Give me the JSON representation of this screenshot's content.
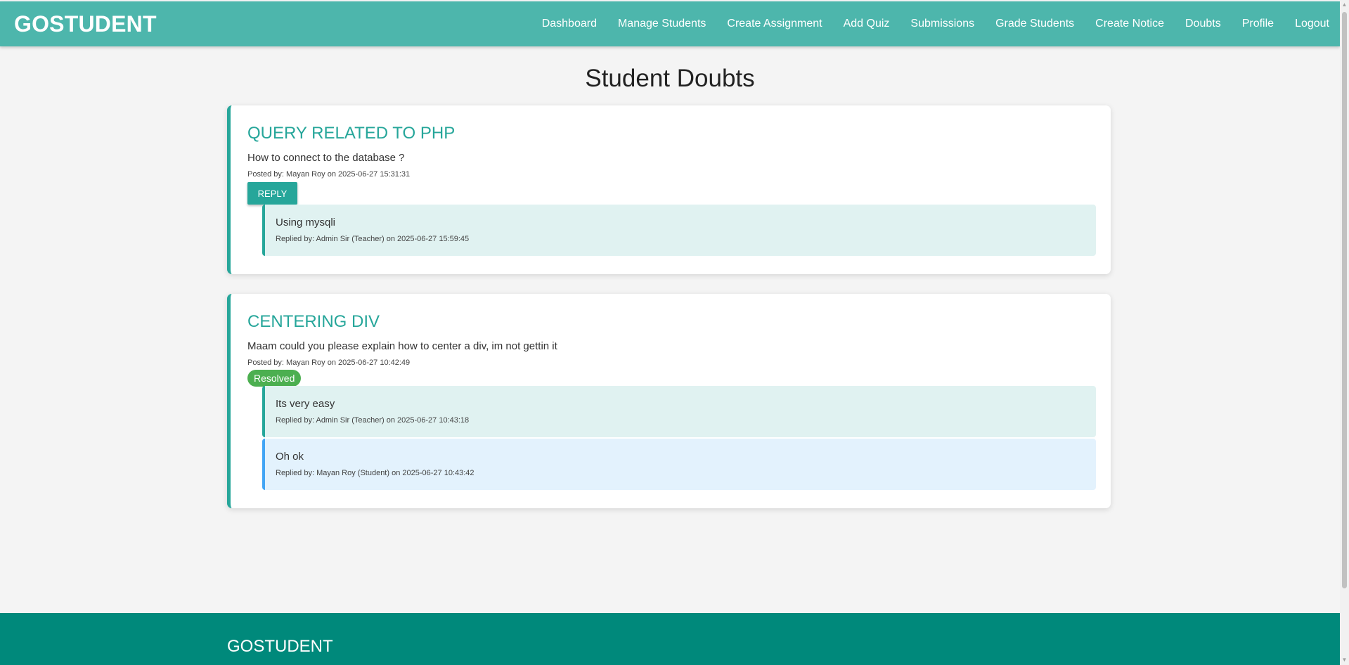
{
  "header": {
    "brand": "GOSTUDENT",
    "nav": [
      {
        "label": "Dashboard"
      },
      {
        "label": "Manage Students"
      },
      {
        "label": "Create Assignment"
      },
      {
        "label": "Add Quiz"
      },
      {
        "label": "Submissions"
      },
      {
        "label": "Grade Students"
      },
      {
        "label": "Create Notice"
      },
      {
        "label": "Doubts"
      },
      {
        "label": "Profile"
      },
      {
        "label": "Logout"
      }
    ]
  },
  "page": {
    "title": "Student Doubts"
  },
  "doubts": [
    {
      "title": "QUERY RELATED TO PHP",
      "question": "How to connect to the database ?",
      "meta": "Posted by: Mayan Roy on 2025-06-27 15:31:31",
      "action_label": "REPLY",
      "replies": [
        {
          "text": "Using mysqli",
          "meta": "Replied by: Admin Sir (Teacher) on 2025-06-27 15:59:45"
        }
      ]
    },
    {
      "title": "CENTERING DIV",
      "question": "Maam could you please explain how to center a div, im not gettin it",
      "meta": "Posted by: Mayan Roy on 2025-06-27 10:42:49",
      "status": "Resolved",
      "replies": [
        {
          "text": "Its very easy",
          "meta": "Replied by: Admin Sir (Teacher) on 2025-06-27 10:43:18"
        },
        {
          "text": "Oh ok",
          "meta": "Replied by: Mayan Roy (Student) on 2025-06-27 10:43:42"
        }
      ]
    }
  ],
  "footer": {
    "brand": "GOSTUDENT"
  },
  "colors": {
    "header_bg": "#4db6ac",
    "accent": "#26a69a",
    "footer_bg": "#00897b",
    "resolved_badge": "#4caf50",
    "teacher_reply_bg": "#e0f2f1",
    "student_reply_bg": "#e3f2fd"
  },
  "icons": {
    "scroll_up": "scroll-up-arrow-icon",
    "scroll_down": "scroll-down-arrow-icon"
  }
}
